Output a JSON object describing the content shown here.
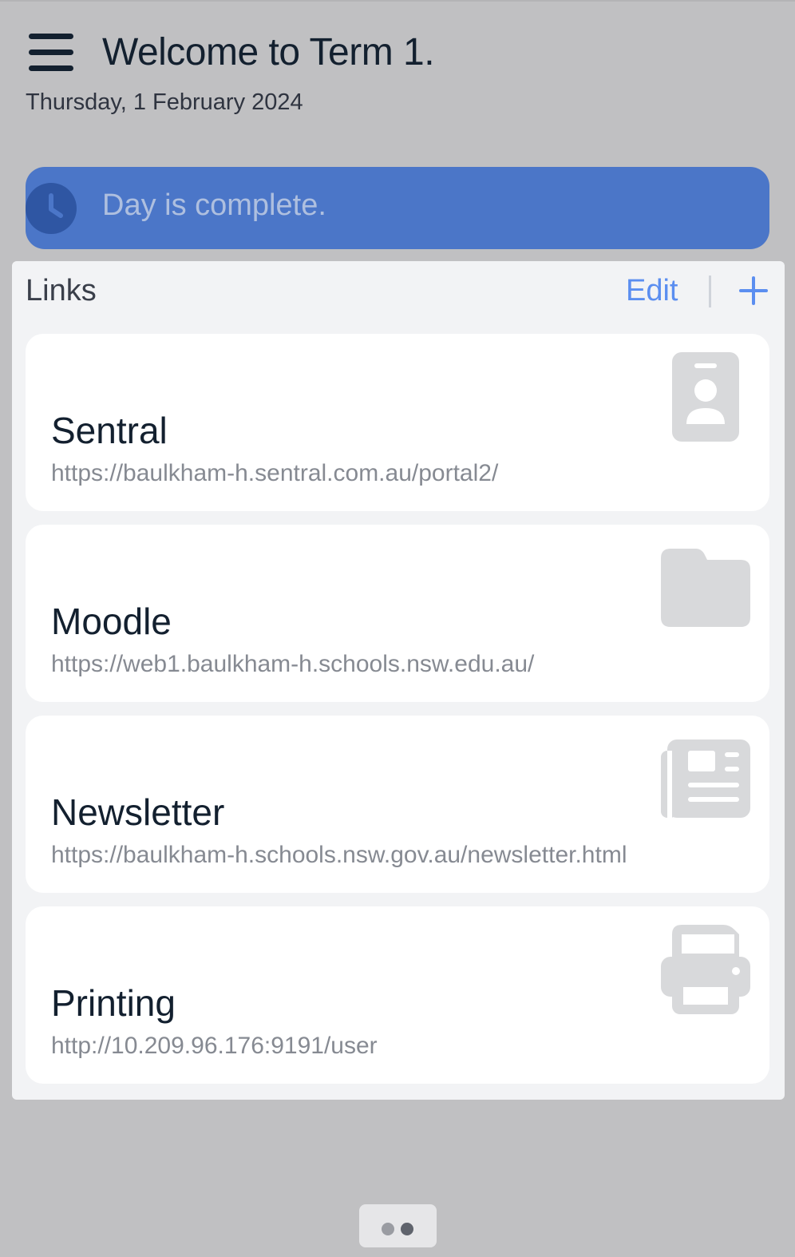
{
  "header": {
    "title": "Welcome to Term 1.",
    "date": "Thursday, 1 February 2024"
  },
  "status": {
    "text": "Day is complete.",
    "color": "#4b76c8"
  },
  "links": {
    "title": "Links",
    "edit_label": "Edit",
    "add_icon": "plus-icon",
    "items": [
      {
        "name": "Sentral",
        "url": "https://baulkham-h.sentral.com.au/portal2/",
        "icon": "id-badge-icon"
      },
      {
        "name": "Moodle",
        "url": "https://web1.baulkham-h.schools.nsw.edu.au/",
        "icon": "folder-icon"
      },
      {
        "name": "Newsletter",
        "url": "https://baulkham-h.schools.nsw.gov.au/newsletter.html",
        "icon": "newspaper-icon"
      },
      {
        "name": "Printing",
        "url": "http://10.209.96.176:9191/user",
        "icon": "printer-icon"
      }
    ]
  },
  "pager": {
    "page_count": 2,
    "active_page": 2
  },
  "colors": {
    "accent": "#5b8ef0",
    "background": "#c0c0c2",
    "text_dark": "#13202f"
  }
}
